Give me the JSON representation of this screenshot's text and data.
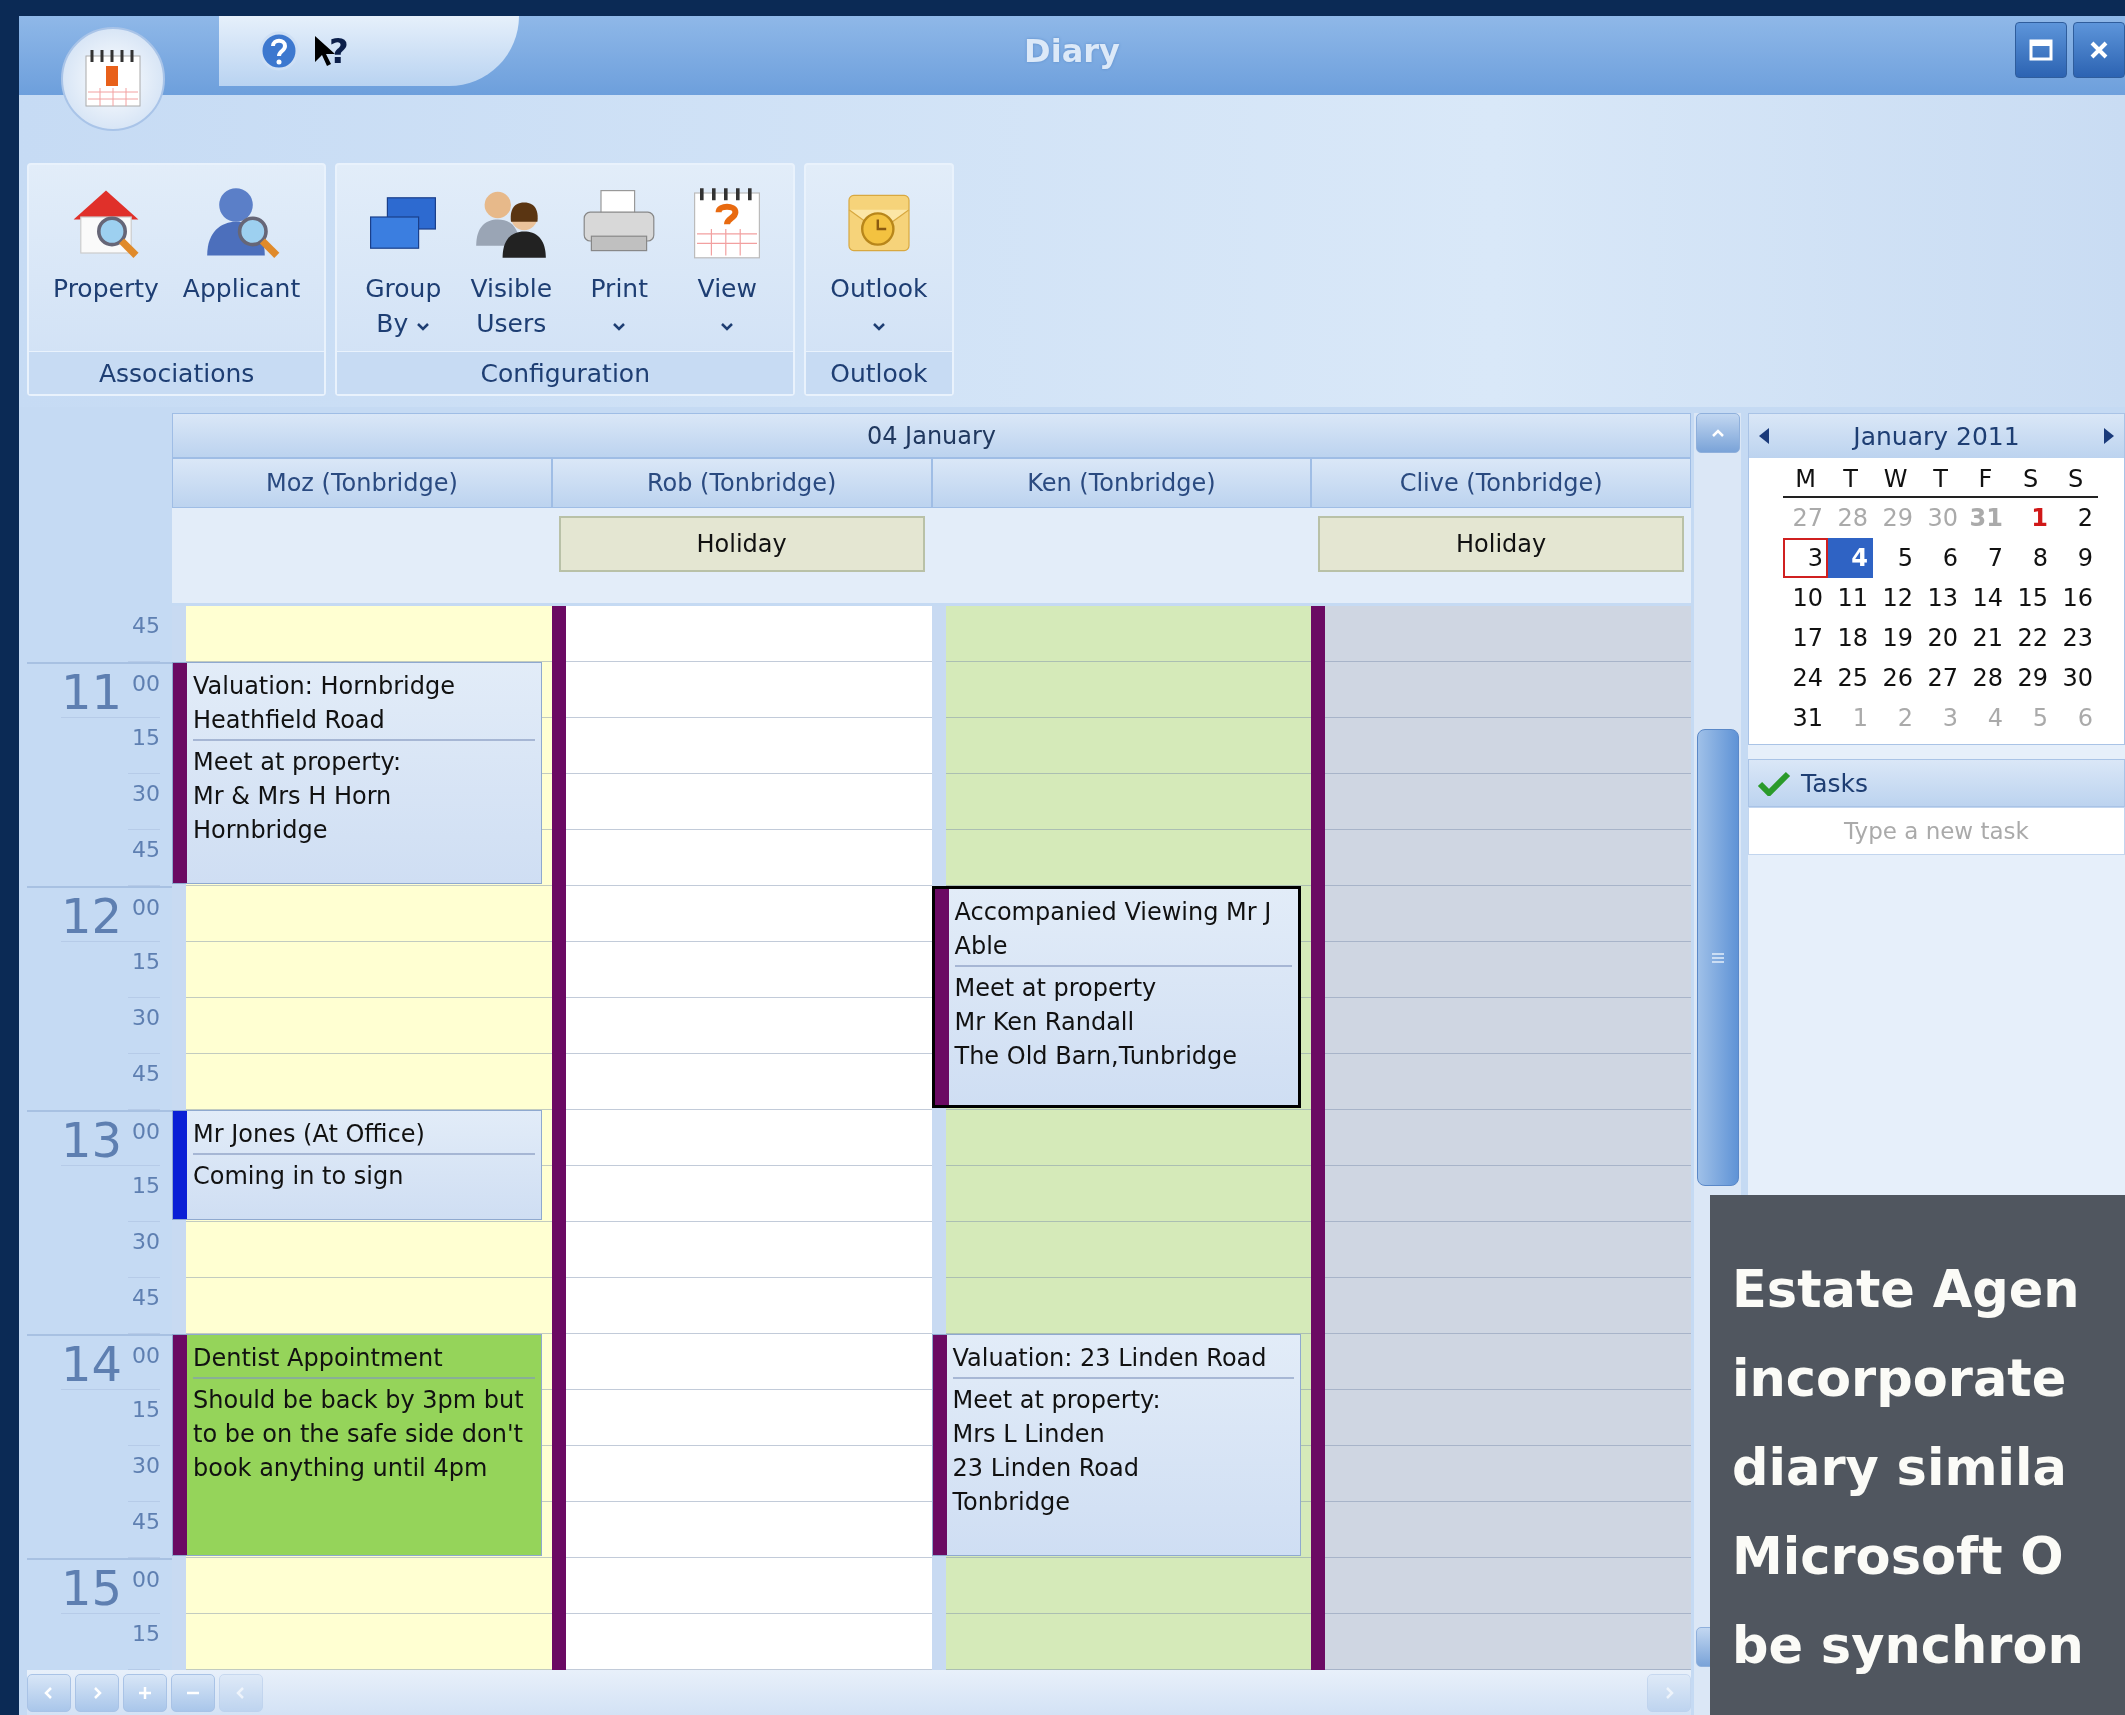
{
  "window": {
    "title": "Diary",
    "help_cursor_label": "?"
  },
  "ribbon": {
    "groups": [
      {
        "label": "Associations",
        "buttons": [
          {
            "kind": "property",
            "lines": [
              "Property"
            ],
            "dropdown": false
          },
          {
            "kind": "applicant",
            "lines": [
              "Applicant"
            ],
            "dropdown": false
          }
        ]
      },
      {
        "label": "Configuration",
        "buttons": [
          {
            "kind": "group",
            "lines": [
              "Group",
              "By"
            ],
            "dropdown": true
          },
          {
            "kind": "users",
            "lines": [
              "Visible",
              "Users"
            ],
            "dropdown": false
          },
          {
            "kind": "print",
            "lines": [
              "Print"
            ],
            "dropdown": true
          },
          {
            "kind": "view",
            "lines": [
              "View"
            ],
            "dropdown": true
          }
        ]
      },
      {
        "label": "Outlook",
        "buttons": [
          {
            "kind": "outlook",
            "lines": [
              "Outlook"
            ],
            "dropdown": true
          }
        ]
      }
    ]
  },
  "diary": {
    "date": "04 January",
    "time_slots": [
      {
        "minute": "45"
      },
      {
        "hour": "11",
        "minute": "00"
      },
      {
        "minute": "15"
      },
      {
        "minute": "30"
      },
      {
        "minute": "45"
      },
      {
        "hour": "12",
        "minute": "00"
      },
      {
        "minute": "15"
      },
      {
        "minute": "30"
      },
      {
        "minute": "45"
      },
      {
        "hour": "13",
        "minute": "00"
      },
      {
        "minute": "15"
      },
      {
        "minute": "30"
      },
      {
        "minute": "45"
      },
      {
        "hour": "14",
        "minute": "00"
      },
      {
        "minute": "15"
      },
      {
        "minute": "30"
      },
      {
        "minute": "45"
      },
      {
        "hour": "15",
        "minute": "00"
      },
      {
        "minute": "15"
      }
    ],
    "columns": [
      {
        "name": "Moz (Tonbridge)",
        "color": "#ffffd2",
        "holiday": false,
        "cells": [
          {
            "kind": "free"
          },
          {
            "kind": "event",
            "title": "Valuation: Hornbridge Heathfield Road",
            "body": "Meet at property:\nMr & Mrs H Horn\nHornbridge",
            "color": "#6b0a63",
            "highlighted": false,
            "selected": false
          },
          {
            "kind": "continued"
          },
          {
            "kind": "continued"
          },
          {
            "kind": "continued"
          },
          {
            "kind": "free"
          },
          {
            "kind": "free"
          },
          {
            "kind": "free"
          },
          {
            "kind": "free"
          },
          {
            "kind": "event",
            "title": "Mr Jones (At Office)",
            "body": "Coming in to sign",
            "color": "#0a1fd6",
            "highlighted": false,
            "selected": false
          },
          {
            "kind": "continued"
          },
          {
            "kind": "free"
          },
          {
            "kind": "free"
          },
          {
            "kind": "event",
            "title": "Dentist Appointment",
            "body": "Should be back by 3pm but to be on the safe side don't book anything until 4pm",
            "color": "#6b0a63",
            "highlighted": true,
            "selected": false
          },
          {
            "kind": "continued"
          },
          {
            "kind": "continued"
          },
          {
            "kind": "continued"
          },
          {
            "kind": "free"
          },
          {
            "kind": "free"
          }
        ]
      },
      {
        "name": "Rob (Tonbridge)",
        "color": "#ffffff",
        "holiday": true,
        "all_day": "Holiday",
        "cells": [
          {
            "kind": "free"
          },
          {
            "kind": "free"
          },
          {
            "kind": "free"
          },
          {
            "kind": "free"
          },
          {
            "kind": "free"
          },
          {
            "kind": "free"
          },
          {
            "kind": "free"
          },
          {
            "kind": "free"
          },
          {
            "kind": "free"
          },
          {
            "kind": "free"
          },
          {
            "kind": "free"
          },
          {
            "kind": "free"
          },
          {
            "kind": "free"
          },
          {
            "kind": "free"
          },
          {
            "kind": "free"
          },
          {
            "kind": "free"
          },
          {
            "kind": "free"
          },
          {
            "kind": "free"
          },
          {
            "kind": "free"
          }
        ]
      },
      {
        "name": "Ken (Tonbridge)",
        "color": "#d5eab9",
        "holiday": false,
        "cells": [
          {
            "kind": "free"
          },
          {
            "kind": "free"
          },
          {
            "kind": "free"
          },
          {
            "kind": "free"
          },
          {
            "kind": "free"
          },
          {
            "kind": "event",
            "title": "Accompanied Viewing Mr J Able",
            "body": "Meet at property\nMr Ken Randall\nThe Old Barn,Tunbridge",
            "color": "#6b0a63",
            "highlighted": false,
            "selected": true
          },
          {
            "kind": "continued"
          },
          {
            "kind": "continued"
          },
          {
            "kind": "continued"
          },
          {
            "kind": "free"
          },
          {
            "kind": "free"
          },
          {
            "kind": "free"
          },
          {
            "kind": "free"
          },
          {
            "kind": "event",
            "title": "Valuation: 23 Linden Road",
            "body": "Meet at property:\nMrs L Linden\n23 Linden Road\nTonbridge",
            "color": "#6b0a63",
            "highlighted": false,
            "selected": false
          },
          {
            "kind": "continued"
          },
          {
            "kind": "continued"
          },
          {
            "kind": "continued"
          },
          {
            "kind": "free"
          },
          {
            "kind": "free"
          }
        ]
      },
      {
        "name": "Clive (Tonbridge)",
        "color": "#cfd6e2",
        "holiday": true,
        "all_day": "Holiday",
        "cells": [
          {
            "kind": "free"
          },
          {
            "kind": "free"
          },
          {
            "kind": "free"
          },
          {
            "kind": "free"
          },
          {
            "kind": "free"
          },
          {
            "kind": "free"
          },
          {
            "kind": "free"
          },
          {
            "kind": "free"
          },
          {
            "kind": "free"
          },
          {
            "kind": "free"
          },
          {
            "kind": "free"
          },
          {
            "kind": "free"
          },
          {
            "kind": "free"
          },
          {
            "kind": "free"
          },
          {
            "kind": "free"
          },
          {
            "kind": "free"
          },
          {
            "kind": "free"
          },
          {
            "kind": "free"
          },
          {
            "kind": "free"
          }
        ]
      }
    ]
  },
  "mini_calendar": {
    "month": "January 2011",
    "weekdays": [
      "M",
      "T",
      "W",
      "T",
      "F",
      "S",
      "S"
    ],
    "weeks": [
      [
        {
          "day": "27",
          "kind": "outside"
        },
        {
          "day": "28",
          "kind": "outside"
        },
        {
          "day": "29",
          "kind": "outside"
        },
        {
          "day": "30",
          "kind": "outside"
        },
        {
          "day": "31",
          "kind": "outside-bold"
        },
        {
          "day": "1",
          "kind": "holiday"
        },
        {
          "day": "2",
          "kind": "normal"
        }
      ],
      [
        {
          "day": "3",
          "kind": "today"
        },
        {
          "day": "4",
          "kind": "selected"
        },
        {
          "day": "5",
          "kind": "normal"
        },
        {
          "day": "6",
          "kind": "normal"
        },
        {
          "day": "7",
          "kind": "normal"
        },
        {
          "day": "8",
          "kind": "normal"
        },
        {
          "day": "9",
          "kind": "normal"
        }
      ],
      [
        {
          "day": "10",
          "kind": "normal"
        },
        {
          "day": "11",
          "kind": "normal"
        },
        {
          "day": "12",
          "kind": "normal"
        },
        {
          "day": "13",
          "kind": "normal"
        },
        {
          "day": "14",
          "kind": "normal"
        },
        {
          "day": "15",
          "kind": "normal"
        },
        {
          "day": "16",
          "kind": "normal"
        }
      ],
      [
        {
          "day": "17",
          "kind": "normal"
        },
        {
          "day": "18",
          "kind": "normal"
        },
        {
          "day": "19",
          "kind": "normal"
        },
        {
          "day": "20",
          "kind": "normal"
        },
        {
          "day": "21",
          "kind": "normal"
        },
        {
          "day": "22",
          "kind": "normal"
        },
        {
          "day": "23",
          "kind": "normal"
        }
      ],
      [
        {
          "day": "24",
          "kind": "normal"
        },
        {
          "day": "25",
          "kind": "normal"
        },
        {
          "day": "26",
          "kind": "normal"
        },
        {
          "day": "27",
          "kind": "normal"
        },
        {
          "day": "28",
          "kind": "normal"
        },
        {
          "day": "29",
          "kind": "normal"
        },
        {
          "day": "30",
          "kind": "normal"
        }
      ],
      [
        {
          "day": "31",
          "kind": "normal"
        },
        {
          "day": "1",
          "kind": "outside"
        },
        {
          "day": "2",
          "kind": "outside"
        },
        {
          "day": "3",
          "kind": "outside"
        },
        {
          "day": "4",
          "kind": "outside"
        },
        {
          "day": "5",
          "kind": "outside"
        },
        {
          "day": "6",
          "kind": "outside"
        }
      ]
    ]
  },
  "tasks": {
    "title": "Tasks",
    "placeholder": "Type a new task"
  },
  "caption": {
    "lines": [
      "Estate Agen",
      "incorporate",
      "diary simila",
      "Microsoft O",
      "be synchron"
    ]
  }
}
